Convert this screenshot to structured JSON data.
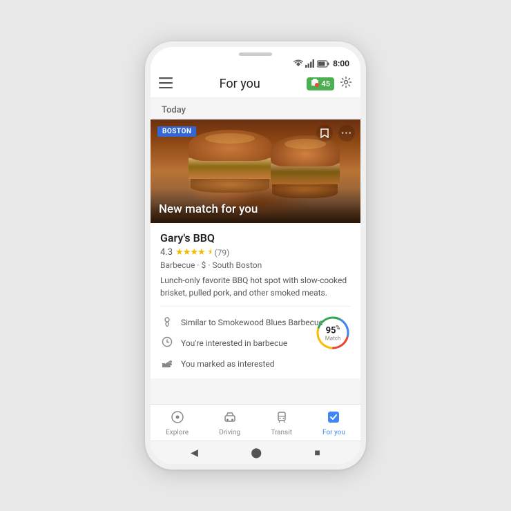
{
  "device": {
    "status_bar": {
      "wifi_icon": "▲",
      "signal_icon": "▲",
      "battery_icon": "▮",
      "time": "8:00"
    }
  },
  "app_bar": {
    "menu_icon": "≡",
    "title": "For you",
    "notification_badge": "45",
    "notification_icon": "🔔",
    "settings_icon": "⚙"
  },
  "feed": {
    "section_label": "Today",
    "card": {
      "location_tag": "BOSTON",
      "bookmark_icon": "🔖",
      "more_icon": "•••",
      "image_headline": "New match for you",
      "restaurant_name": "Gary's BBQ",
      "rating": "4.3",
      "stars": "★★★★",
      "half_star": "½",
      "review_count": "(79)",
      "meta": "Barbecue · $ · South Boston",
      "description": "Lunch-only favorite BBQ hot spot with slow-cooked brisket, pulled pork, and other smoked meats.",
      "reasons": [
        {
          "icon": "📍",
          "text": "Similar to Smokewood Blues Barbecue"
        },
        {
          "icon": "⏱",
          "text": "You're interested in barbecue"
        },
        {
          "icon": "👍",
          "text": "You marked as interested"
        }
      ],
      "match_percent": "95",
      "match_label": "Match",
      "ring_colors": {
        "blue": "#4285F4",
        "red": "#EA4335",
        "yellow": "#FBBC05",
        "green": "#34A853"
      }
    }
  },
  "bottom_nav": {
    "items": [
      {
        "icon": "📍",
        "label": "Explore",
        "active": false
      },
      {
        "icon": "🚗",
        "label": "Driving",
        "active": false
      },
      {
        "icon": "🚌",
        "label": "Transit",
        "active": false
      },
      {
        "icon": "⭐",
        "label": "For you",
        "active": true
      }
    ]
  },
  "android_nav": {
    "back": "◀",
    "home": "⬤",
    "recents": "■"
  }
}
